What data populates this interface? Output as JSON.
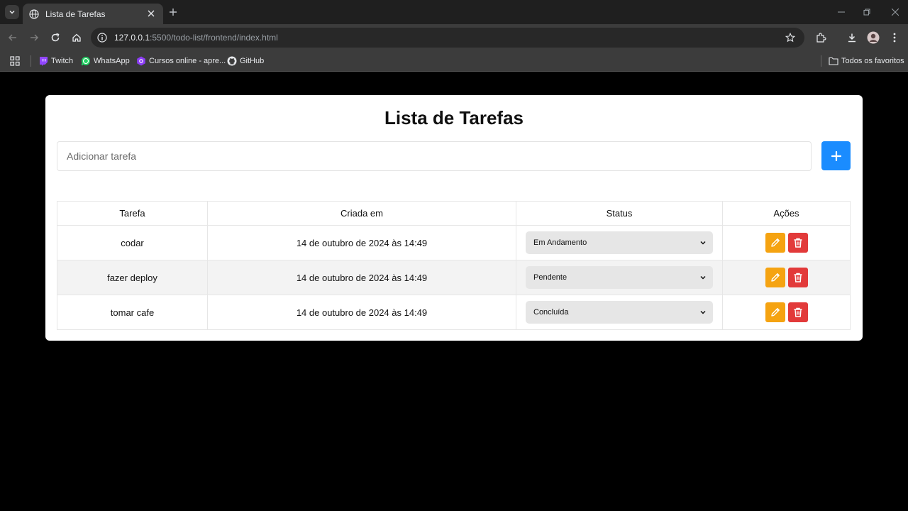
{
  "browser": {
    "tab_title": "Lista de Tarefas",
    "url_host": "127.0.0.1",
    "url_rest": ":5500/todo-list/frontend/index.html",
    "bookmarks": [
      "Twitch",
      "WhatsApp",
      "Cursos online - apre...",
      "GitHub"
    ],
    "all_bookmarks_label": "Todos os favoritos"
  },
  "page": {
    "title": "Lista de Tarefas",
    "input_placeholder": "Adicionar tarefa",
    "add_button_label": "+",
    "accent_color": "#1a8cff"
  },
  "table": {
    "headers": [
      "Tarefa",
      "Criada em",
      "Status",
      "Ações"
    ],
    "rows": [
      {
        "task": "codar",
        "created": "14 de outubro de 2024 às 14:49",
        "status": "Em Andamento"
      },
      {
        "task": "fazer deploy",
        "created": "14 de outubro de 2024 às 14:49",
        "status": "Pendente"
      },
      {
        "task": "tomar cafe",
        "created": "14 de outubro de 2024 às 14:49",
        "status": "Concluída"
      }
    ]
  },
  "icons": {
    "edit": "pencil-icon",
    "delete": "trash-icon",
    "status_chevron": "chevron-down-icon"
  },
  "colors": {
    "edit_button": "#f5a311",
    "delete_button": "#e23a3a"
  }
}
